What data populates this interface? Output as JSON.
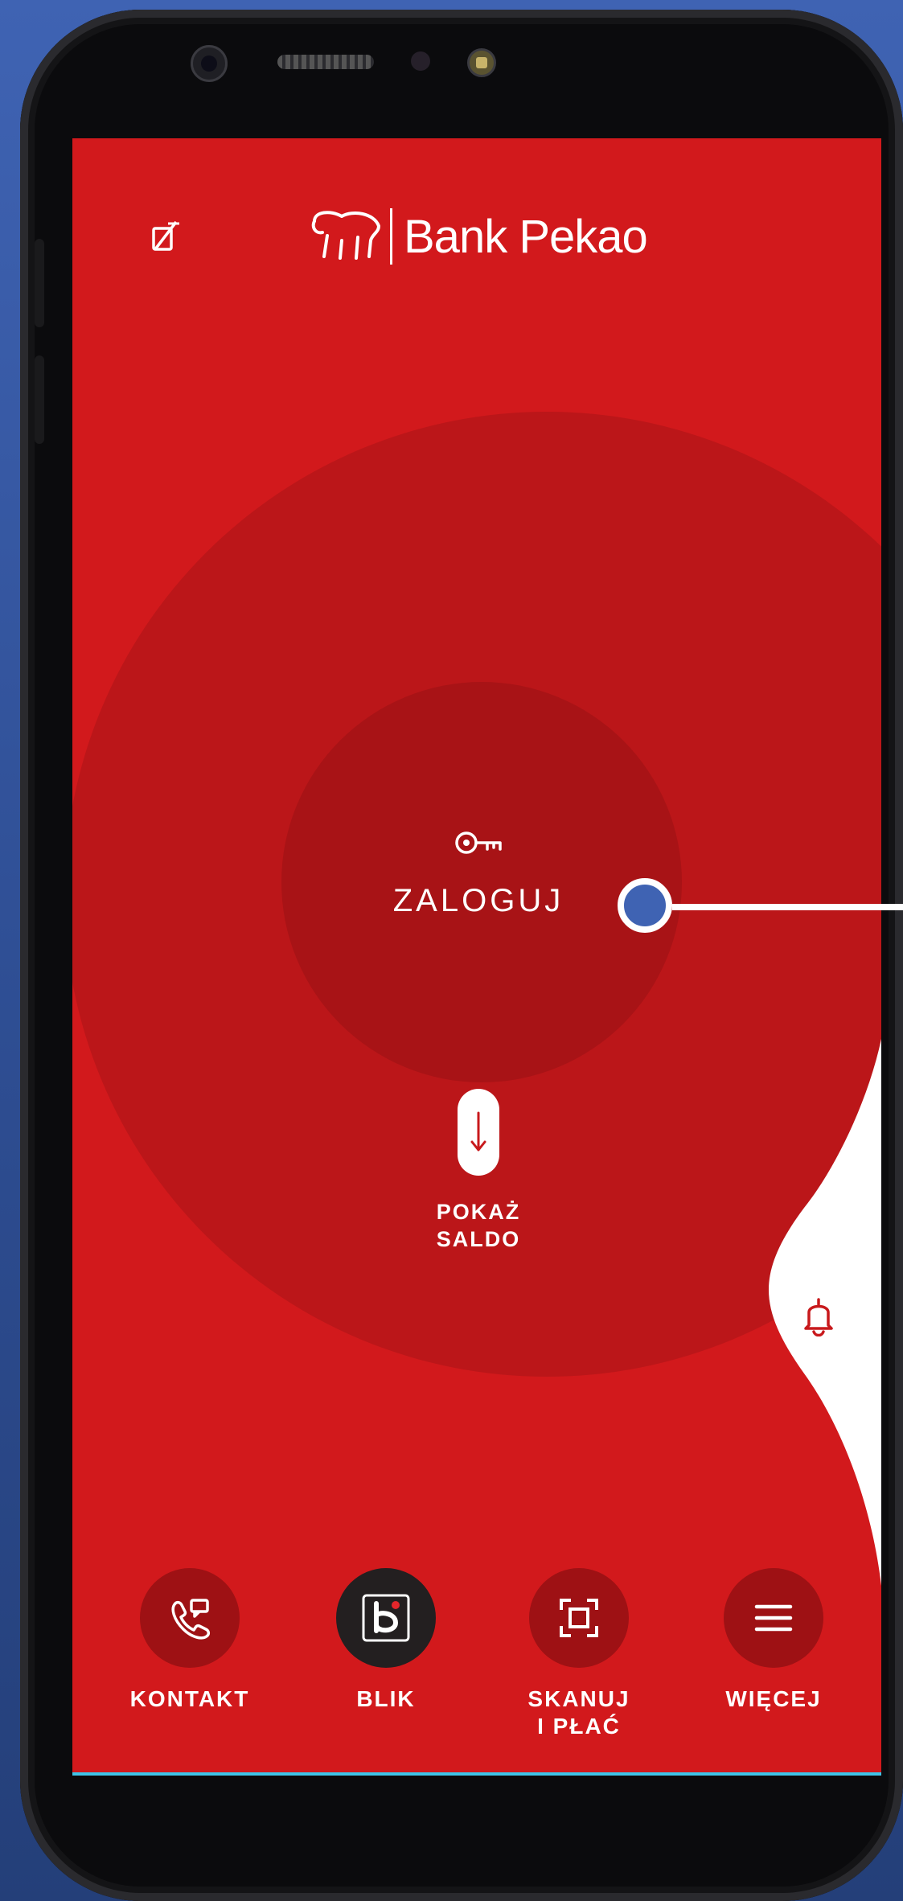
{
  "brand": {
    "name": "Bank Pekao"
  },
  "header": {
    "device_icon": "phone-off-icon"
  },
  "login": {
    "icon": "key-icon",
    "label": "ZALOGUJ"
  },
  "balance": {
    "handle_icon": "arrow-down-icon",
    "label": "POKAŻ\nSALDO"
  },
  "notifications": {
    "icon": "bell-icon"
  },
  "nav": [
    {
      "label": "KONTAKT",
      "icon": "phone-chat-icon"
    },
    {
      "label": "BLIK",
      "icon": "blik-icon"
    },
    {
      "label": "SKANUJ\nI PŁAĆ",
      "icon": "scan-icon"
    },
    {
      "label": "WIĘCEJ",
      "icon": "menu-icon"
    }
  ],
  "colors": {
    "primary_red": "#d2191c",
    "outer_circle": "#bb1619",
    "inner_circle": "#a81316",
    "nav_circle": "#9e1114",
    "blik_circle": "#231f20",
    "background": "#3f63b3"
  }
}
